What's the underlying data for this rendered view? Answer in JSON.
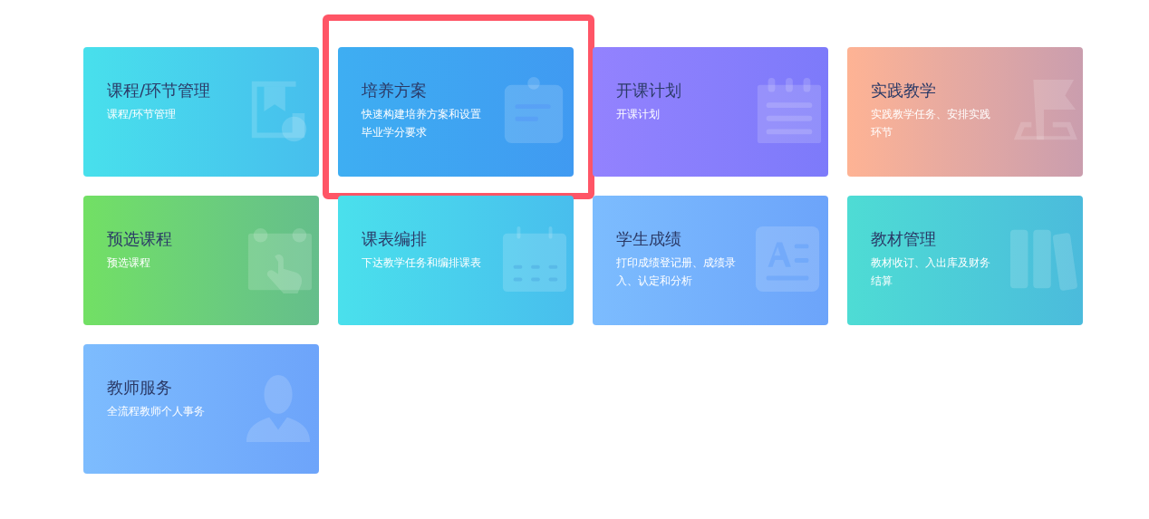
{
  "cards": [
    {
      "title": "课程/环节管理",
      "subtitle": "课程/环节管理",
      "kind": "book-gear",
      "color": "#48e0ec",
      "highlighted": false
    },
    {
      "title": "培养方案",
      "subtitle": "快速构建培养方案和设置毕业学分要求",
      "kind": "clipboard",
      "color": "#3eaef2",
      "highlighted": true
    },
    {
      "title": "开课计划",
      "subtitle": "开课计划",
      "kind": "notepad",
      "color": "#9382fe",
      "highlighted": false
    },
    {
      "title": "实践教学",
      "subtitle": "实践教学任务、安排实践环节",
      "kind": "flag",
      "color": "#feb394",
      "highlighted": false
    },
    {
      "title": "预选课程",
      "subtitle": "预选课程",
      "kind": "calendar-hand",
      "color": "#72e064",
      "highlighted": false
    },
    {
      "title": "课表编排",
      "subtitle": "下达教学任务和编排课表",
      "kind": "calendar",
      "color": "#4ae0ec",
      "highlighted": false
    },
    {
      "title": "学生成绩",
      "subtitle": "打印成绩登记册、成绩录入、认定和分析",
      "kind": "document",
      "color": "#7cbcfe",
      "highlighted": false
    },
    {
      "title": "教材管理",
      "subtitle": "教材收订、入出库及财务结算",
      "kind": "books",
      "color": "#4edcd4",
      "highlighted": false
    },
    {
      "title": "教师服务",
      "subtitle": "全流程教师个人事务",
      "kind": "person",
      "color": "#7dbcfe",
      "highlighted": false
    }
  ]
}
